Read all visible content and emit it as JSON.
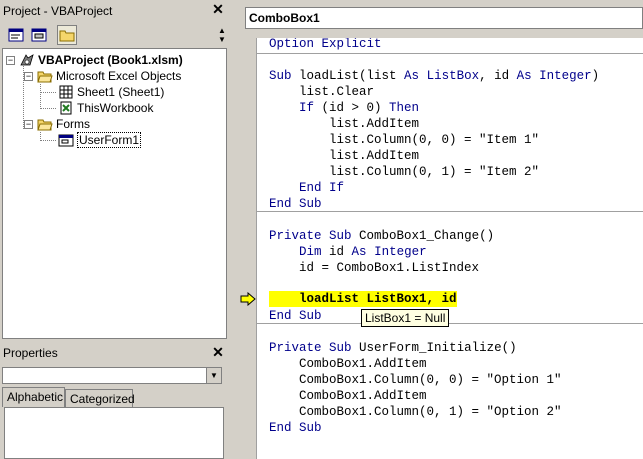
{
  "project": {
    "title": "Project - VBAProject",
    "tree": {
      "root_label": "VBAProject (Book1.xlsm)",
      "excel_objects_label": "Microsoft Excel Objects",
      "sheet1_label": "Sheet1 (Sheet1)",
      "thisworkbook_label": "ThisWorkbook",
      "forms_label": "Forms",
      "userform1_label": "UserForm1"
    }
  },
  "properties": {
    "title": "Properties",
    "combo_value": "",
    "tabs": [
      "Alphabetic",
      "Categorized"
    ]
  },
  "code_window": {
    "object_selector": "ComboBox1",
    "tooltip": "ListBox1 = Null",
    "lines": {
      "l1": "Option Explicit",
      "l3": "Sub loadList(list As ListBox, id As Integer)",
      "l4": "    list.Clear",
      "l5": "    If (id > 0) Then",
      "l6": "        list.AddItem",
      "l7": "        list.Column(0, 0) = \"Item 1\"",
      "l8": "        list.AddItem",
      "l9": "        list.Column(0, 1) = \"Item 2\"",
      "l10": "    End If",
      "l11": "End Sub",
      "l13": "Private Sub ComboBox1_Change()",
      "l14": "    Dim id As Integer",
      "l15": "    id = ComboBox1.ListIndex",
      "l17": "    loadList ListBox1, id",
      "l18": "End Sub",
      "l20": "Private Sub UserForm_Initialize()",
      "l21": "    ComboBox1.AddItem",
      "l22": "    ComboBox1.Column(0, 0) = \"Option 1\"",
      "l23": "    ComboBox1.AddItem",
      "l24": "    ComboBox1.Column(0, 1) = \"Option 2\"",
      "l25": "End Sub"
    }
  },
  "colors": {
    "keyword": "#00008b",
    "execution_highlight": "#ffff00",
    "breakpoint_bar": "#800000",
    "tooltip_bg": "#ffffe1"
  }
}
